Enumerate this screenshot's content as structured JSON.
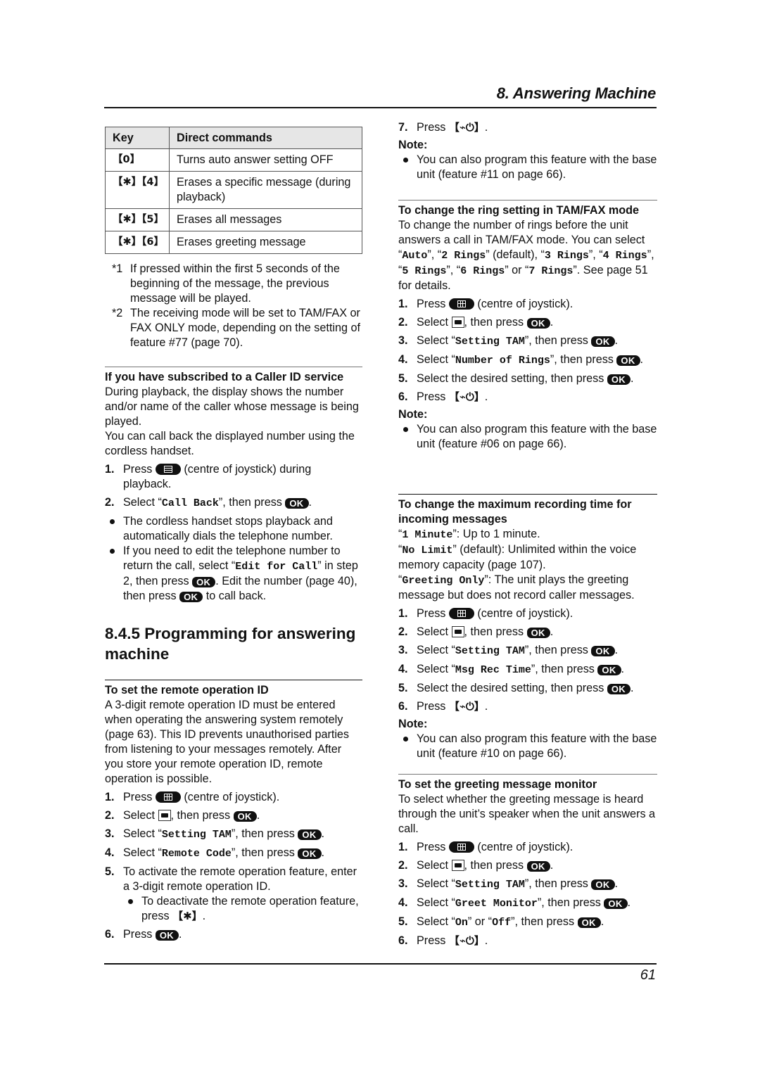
{
  "header": {
    "title": "8. Answering Machine"
  },
  "footer": {
    "page_number": "61"
  },
  "table": {
    "headers": [
      "Key",
      "Direct commands"
    ],
    "rows": [
      {
        "key": "【0】",
        "command": "Turns auto answer setting OFF"
      },
      {
        "key": "【✱】【4】",
        "command": "Erases a specific message (during playback)"
      },
      {
        "key": "【✱】【5】",
        "command": "Erases all messages"
      },
      {
        "key": "【✱】【6】",
        "command": "Erases greeting message"
      }
    ]
  },
  "footnotes": [
    {
      "mark": "*1",
      "text": "If pressed within the first 5 seconds of the beginning of the message, the previous message will be played."
    },
    {
      "mark": "*2",
      "text": "The receiving mode will be set to TAM/FAX or FAX ONLY mode, depending on the setting of feature #77 (page 70)."
    }
  ],
  "caller_id": {
    "title": "If you have subscribed to a Caller ID service",
    "para1": "During playback, the display shows the number and/or name of the caller whose message is being played.",
    "para2": "You can call back the displayed number using the cordless handset.",
    "step1_num": "1.",
    "step1_a": "Press",
    "step1_b": "(centre of joystick) during playback.",
    "step2_num": "2.",
    "step2_a": "Select “",
    "step2_mono": "Call Back",
    "step2_b": "”, then press",
    "bullet1": "The cordless handset stops playback and automatically dials the telephone number.",
    "bullet2_a": "If you need to edit the telephone number to return the call, select “",
    "bullet2_mono": "Edit for Call",
    "bullet2_b": "” in step 2, then press",
    "bullet2_c": ". Edit the number (page 40), then press",
    "bullet2_d": "to call back."
  },
  "section": {
    "title": "8.4.5 Programming for answering machine"
  },
  "remote_id": {
    "title": "To set the remote operation ID",
    "para": "A 3-digit remote operation ID must be entered when operating the answering system remotely (page 63). This ID prevents unauthorised parties from listening to your messages remotely. After you store your remote operation ID, remote operation is possible.",
    "s1": "Press",
    "s1b": "(centre of joystick).",
    "s2": "Select",
    "s2b": ", then press",
    "s3": "Select “",
    "s3m": "Setting TAM",
    "s3b": "”, then press",
    "s4": "Select “",
    "s4m": "Remote Code",
    "s4b": "”, then press",
    "s5": "To activate the remote operation feature, enter a 3-digit remote operation ID.",
    "s5_bullet_a": "To deactivate the remote operation feature, press",
    "s5_bullet_key": "【✱】",
    "s6": "Press"
  },
  "common": {
    "ok": "OK",
    "off_key": "【⌁⏻】",
    "note": "Note:",
    "period": ".",
    "nums": [
      "1.",
      "2.",
      "3.",
      "4.",
      "5.",
      "6.",
      "7."
    ]
  },
  "ring": {
    "step7": "Press",
    "note1": "You can also program this feature with the base unit (feature #11 on page 66).",
    "title": "To change the ring setting in TAM/FAX mode",
    "para_a": "To change the number of rings before the unit answers a call in TAM/FAX mode. You can select “",
    "opt1": "Auto",
    "sep1": "”, “",
    "opt2": "2 Rings",
    "sep2": "” (default), “",
    "opt3": "3 Rings",
    "sep3": "”, “",
    "opt4": "4 Rings",
    "sep4": "”, “",
    "opt5": "5 Rings",
    "sep5": "”, “",
    "opt6": "6 Rings",
    "sep6": "” or “",
    "opt7": "7 Rings",
    "para_b": "”. See page 51 for details.",
    "s1": "Press",
    "s1b": "(centre of joystick).",
    "s2": "Select",
    "s2b": ", then press",
    "s3": "Select “",
    "s3m": "Setting TAM",
    "s3b": "”, then press",
    "s4": "Select “",
    "s4m": "Number of Rings",
    "s4b": "”, then press",
    "s5": "Select the desired setting, then press",
    "s6": "Press",
    "note2": "You can also program this feature with the base unit (feature #06 on page 66)."
  },
  "rec_time": {
    "title": "To change the maximum recording time for incoming messages",
    "o1m": "1 Minute",
    "o1": "”: Up to 1 minute.",
    "o2m": "No Limit",
    "o2": "” (default): Unlimited within the voice memory capacity (page 107).",
    "o3m": "Greeting Only",
    "o3": "”: The unit plays the greeting message but does not record caller messages.",
    "s1": "Press",
    "s1b": "(centre of joystick).",
    "s2": "Select",
    "s2b": ", then press",
    "s3": "Select “",
    "s3m": "Setting TAM",
    "s3b": "”, then press",
    "s4": "Select “",
    "s4m": "Msg Rec Time",
    "s4b": "”, then press",
    "s5": "Select the desired setting, then press",
    "s6": "Press",
    "note": "You can also program this feature with the base unit (feature #10 on page 66)."
  },
  "greeting": {
    "title": "To set the greeting message monitor",
    "para": "To select whether the greeting message is heard through the unit’s speaker when the unit answers a call.",
    "s1": "Press",
    "s1b": "(centre of joystick).",
    "s2": "Select",
    "s2b": ", then press",
    "s3": "Select “",
    "s3m": "Setting TAM",
    "s3b": "”, then press",
    "s4": "Select “",
    "s4m": "Greet Monitor",
    "s4b": "”, then press",
    "s5": "Select “",
    "s5m1": "On",
    "s5mid": "” or “",
    "s5m2": "Off",
    "s5b": "”, then press",
    "s6": "Press"
  }
}
